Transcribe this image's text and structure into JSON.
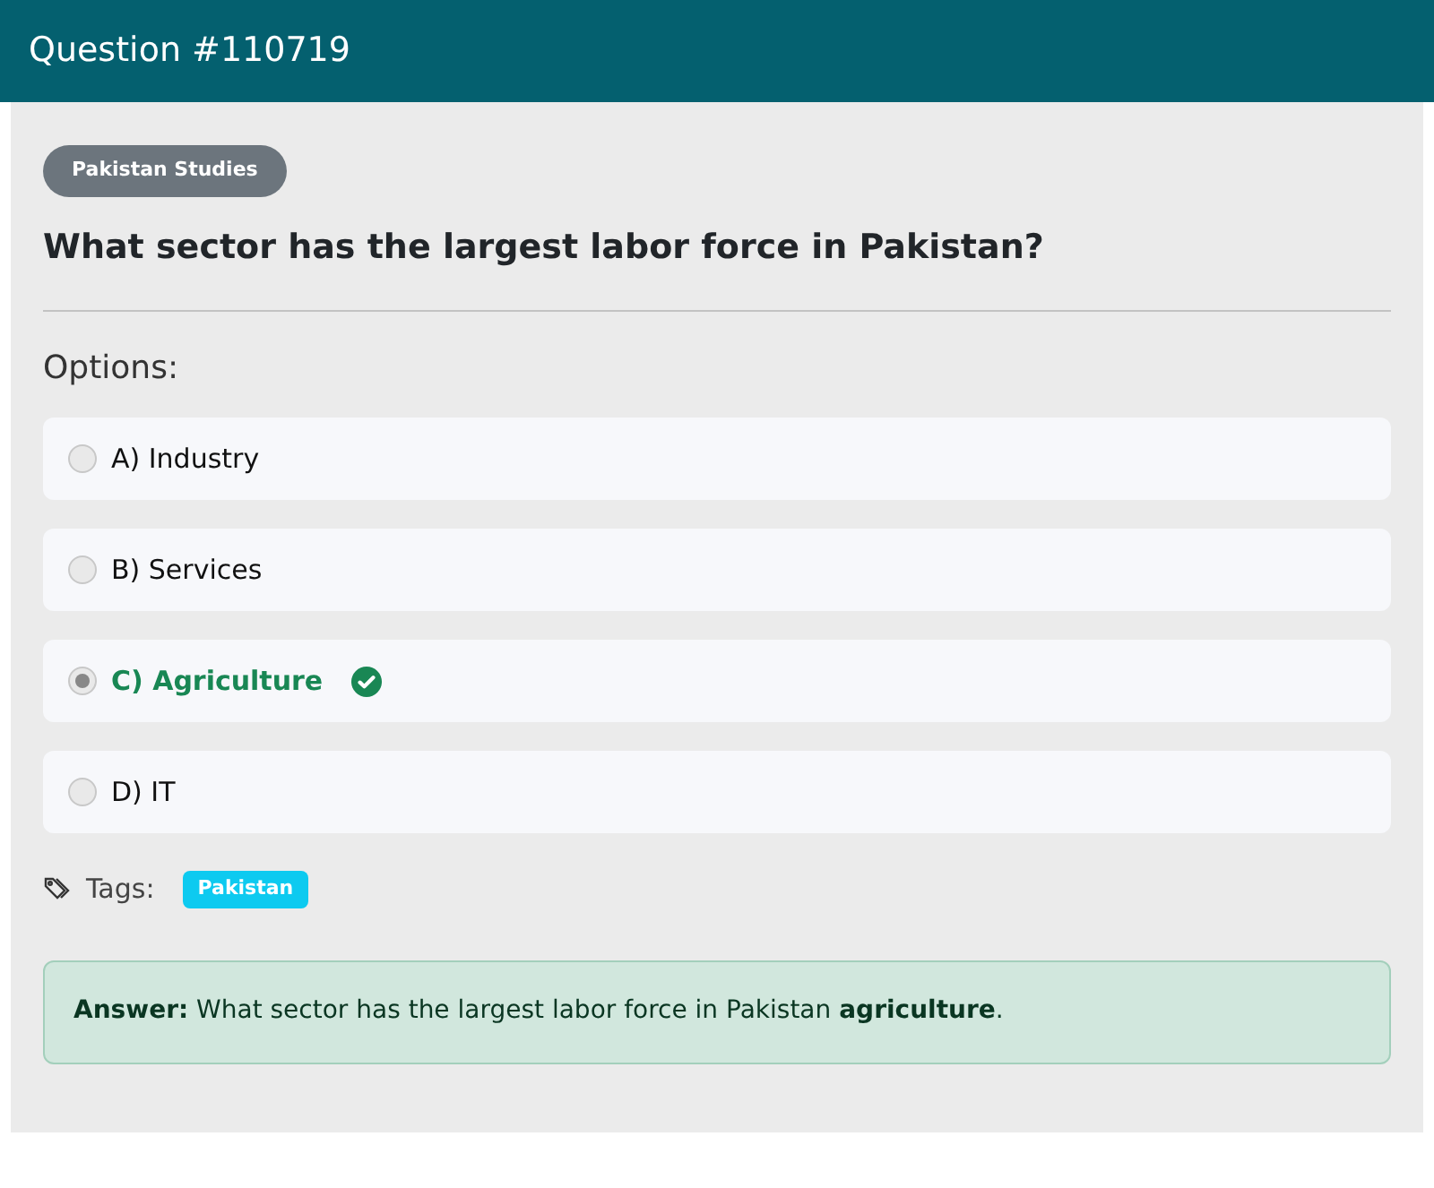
{
  "header": {
    "title": "Question #110719"
  },
  "category": "Pakistan Studies",
  "question": "What sector has the largest labor force in Pakistan?",
  "options_label": "Options:",
  "options": [
    {
      "label": "A) Industry",
      "selected": false,
      "correct": false
    },
    {
      "label": "B) Services",
      "selected": false,
      "correct": false
    },
    {
      "label": "C) Agriculture",
      "selected": true,
      "correct": true
    },
    {
      "label": "D) IT",
      "selected": false,
      "correct": false
    }
  ],
  "tags_label": "Tags:",
  "tags": [
    "Pakistan"
  ],
  "answer": "**Answer:** What sector has the largest labor force in Pakistan **agriculture**."
}
